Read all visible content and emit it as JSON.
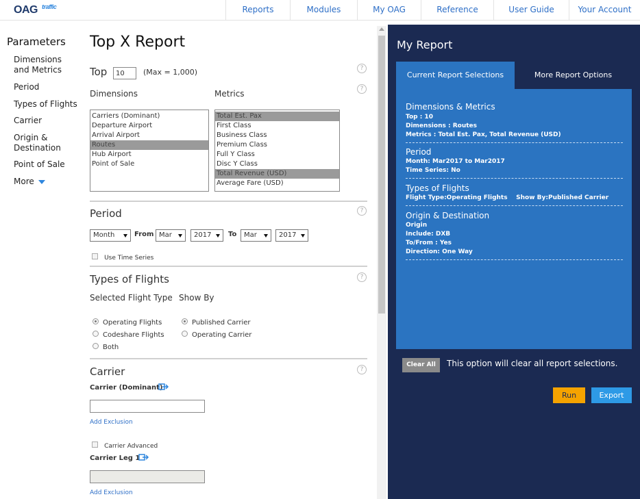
{
  "header": {
    "logo_main": "OAG",
    "logo_sub": "traffic",
    "nav": [
      "Reports",
      "Modules",
      "My OAG",
      "Reference",
      "User Guide",
      "Your Account"
    ]
  },
  "sidebar": {
    "title": "Parameters",
    "items": [
      "Dimensions and Metrics",
      "Period",
      "Types of Flights",
      "Carrier",
      "Origin & Destination",
      "Point of Sale"
    ],
    "more": "More"
  },
  "main": {
    "title": "Top X Report",
    "top_label": "Top",
    "top_value": "10",
    "top_max": "(Max = 1,000)",
    "dimensions_label": "Dimensions",
    "metrics_label": "Metrics",
    "dimensions": [
      "Carriers (Dominant)",
      "Departure Airport",
      "Arrival Airport",
      "Routes",
      "Hub Airport",
      "Point of Sale"
    ],
    "metrics": [
      "Total Est. Pax",
      "First Class",
      "Business Class",
      "Premium Class",
      "Full Y Class",
      "Disc Y Class",
      "Total Revenue (USD)",
      "Average Fare (USD)"
    ],
    "period": {
      "title": "Period",
      "unit": "Month",
      "from_label": "From",
      "from_month": "Mar",
      "from_year": "2017",
      "to_label": "To",
      "to_month": "Mar",
      "to_year": "2017",
      "time_series": "Use Time Series"
    },
    "flights": {
      "title": "Types of Flights",
      "selected_label": "Selected Flight Type",
      "showby_label": "Show By",
      "types": [
        "Operating Flights",
        "Codeshare Flights",
        "Both"
      ],
      "showby": [
        "Published Carrier",
        "Operating Carrier"
      ]
    },
    "carrier": {
      "title": "Carrier",
      "dominant_label": "Carrier (Dominant)",
      "add_exclusion": "Add Exclusion",
      "advanced": "Carrier Advanced",
      "leg_label": "Carrier Leg 1",
      "add_exclusion2": "Add Exclusion"
    },
    "help": "?"
  },
  "report": {
    "title": "My Report",
    "tab_current": "Current Report Selections",
    "tab_more": "More Report Options",
    "dm": {
      "title": "Dimensions & Metrics",
      "top": "Top : 10",
      "dims": "Dimensions : Routes",
      "metrics": "Metrics : Total Est. Pax, Total Revenue (USD)"
    },
    "period": {
      "title": "Period",
      "month": "Month: Mar2017  to Mar2017",
      "ts": "Time Series: No"
    },
    "types": {
      "title": "Types of Flights",
      "line": "Flight Type:Operating Flights    Show By:Published Carrier"
    },
    "od": {
      "title": "Origin & Destination",
      "l1": "Origin",
      "l2": "Include: DXB",
      "l3": "To/From : Yes",
      "l4": "Direction: One Way"
    },
    "clear_all": "Clear All",
    "clear_text": "This option will clear all report selections.",
    "run": "Run",
    "export": "Export"
  }
}
